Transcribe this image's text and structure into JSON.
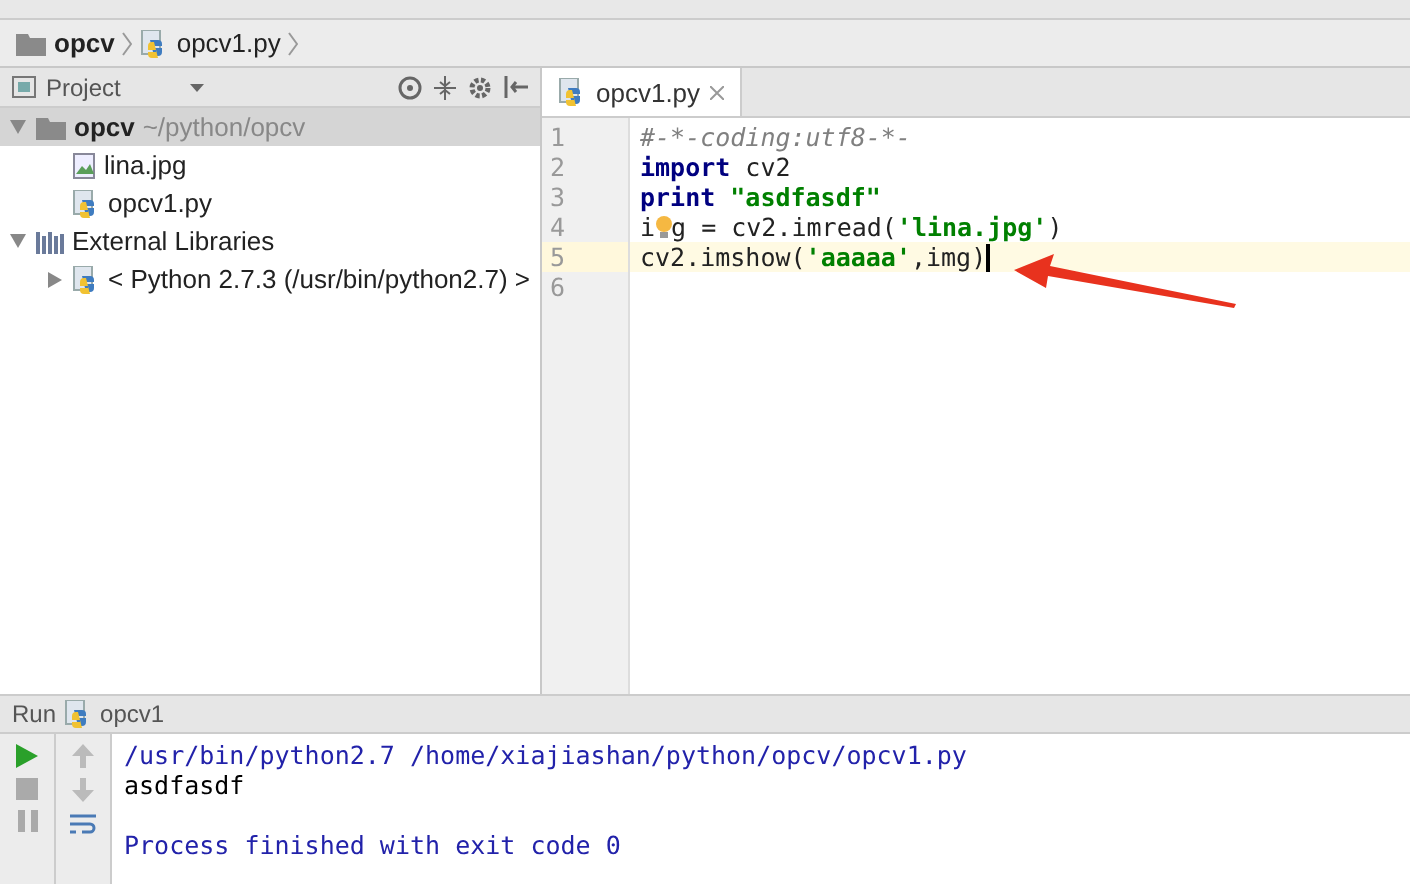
{
  "breadcrumbs": [
    {
      "label": "opcv",
      "kind": "folder"
    },
    {
      "label": "opcv1.py",
      "kind": "python"
    }
  ],
  "project_panel": {
    "title": "Project",
    "tree": [
      {
        "label": "opcv",
        "path": "~/python/opcv",
        "kind": "folder",
        "expanded": true,
        "selected": true,
        "children": [
          {
            "label": "lina.jpg",
            "kind": "image",
            "selected": false
          },
          {
            "label": "opcv1.py",
            "kind": "python",
            "selected": false
          }
        ]
      },
      {
        "label": "External Libraries",
        "kind": "library",
        "expanded": true,
        "selected": false,
        "children": [
          {
            "label": "< Python 2.7.3 (/usr/bin/python2.7) >",
            "kind": "python",
            "expanded": false,
            "selected": false
          }
        ]
      }
    ]
  },
  "editor": {
    "tabs": [
      {
        "label": "opcv1.py",
        "selected": true
      }
    ],
    "lines": [
      {
        "number": "1",
        "current": false,
        "tokens": [
          {
            "kind": "comment",
            "text": "#-*-coding:utf8-*-"
          }
        ]
      },
      {
        "number": "2",
        "current": false,
        "tokens": [
          {
            "kind": "keyword",
            "text": "import"
          },
          {
            "kind": "plain",
            "text": " cv2"
          }
        ]
      },
      {
        "number": "3",
        "current": false,
        "tokens": [
          {
            "kind": "keyword",
            "text": "print "
          },
          {
            "kind": "string",
            "text": "\"asdfasdf\""
          }
        ]
      },
      {
        "number": "4",
        "current": false,
        "tokens": [
          {
            "kind": "plain",
            "text": "i"
          },
          {
            "kind": "bulb"
          },
          {
            "kind": "plain",
            "text": "g = cv2.imread("
          },
          {
            "kind": "string",
            "text": "'lina.jpg'"
          },
          {
            "kind": "plain",
            "text": ")"
          }
        ]
      },
      {
        "number": "5",
        "current": true,
        "tokens": [
          {
            "kind": "plain",
            "text": "cv2.imshow("
          },
          {
            "kind": "string",
            "text": "'aaaaa'"
          },
          {
            "kind": "plain",
            "text": ",img)"
          }
        ]
      },
      {
        "number": "6",
        "current": false
      }
    ]
  },
  "run_panel": {
    "title": "Run",
    "config": "opcv1",
    "output": [
      {
        "kind": "command",
        "text": "/usr/bin/python2.7 /home/xiajiashan/python/opcv/opcv1.py"
      },
      {
        "kind": "stdout",
        "text": "asdfasdf"
      },
      {
        "kind": "system",
        "text": "Process finished with exit code 0"
      }
    ]
  }
}
